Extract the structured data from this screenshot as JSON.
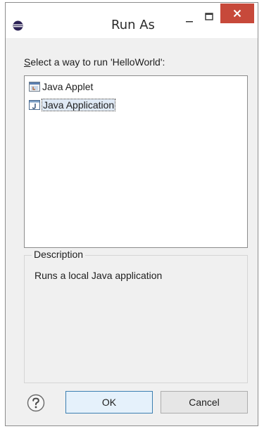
{
  "window": {
    "title": "Run As",
    "controls": {
      "minimize_icon": "minimize-icon",
      "maximize_icon": "maximize-icon",
      "close_icon": "close-icon"
    },
    "close_color": "#c7493a"
  },
  "prompt": {
    "accel": "S",
    "rest": "elect a way to run 'HelloWorld':"
  },
  "list": {
    "items": [
      {
        "label": "Java Applet",
        "icon": "java-applet-icon",
        "selected": false
      },
      {
        "label": "Java Application",
        "icon": "java-application-icon",
        "selected": true
      }
    ]
  },
  "description": {
    "legend": "Description",
    "text": "Runs a local Java application"
  },
  "buttons": {
    "ok": "OK",
    "cancel": "Cancel",
    "help_icon": "help-icon"
  }
}
